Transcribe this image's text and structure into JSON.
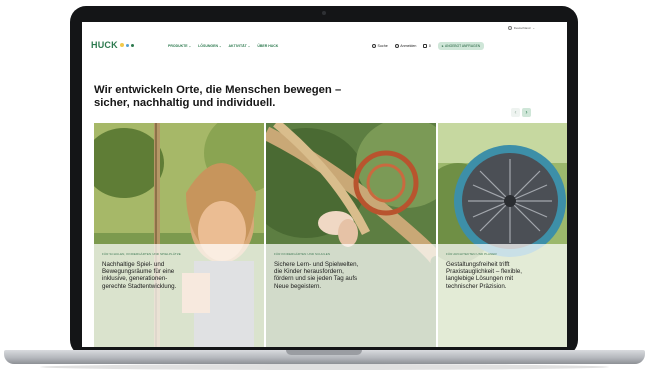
{
  "top_bar": {
    "language": "Deutschland"
  },
  "header": {
    "logo": "HUCK",
    "nav": [
      "PRODUKTE",
      "LÖSUNGEN",
      "AKTIVITÄT",
      "ÜBER HUCK"
    ],
    "search_label": "Suche",
    "login_label": "Anmelden",
    "cart_count": "0",
    "cta_label": "ANGEBOT ANFRAGEN"
  },
  "hero": {
    "headline_line1": "Wir entwickeln Orte, die Menschen bewegen –",
    "headline_line2": "sicher, nachhaltig und individuell."
  },
  "cards": [
    {
      "category": "FÜR SCHULEN, KINDERGÄRTEN UND SPIELPLÄTZE",
      "lines": [
        "Nachhaltige Spiel- und",
        "Bewegungsräume für eine",
        "inklusive, generationen-",
        "gerechte Stadtentwicklung."
      ]
    },
    {
      "category": "FÜR KINDERGÄRTEN UND SCHULEN",
      "lines": [
        "Sichere Lern- und Spielwelten,",
        "die Kinder herausfordern,",
        "fördern und sie jeden Tag aufs",
        "Neue begeistern."
      ]
    },
    {
      "category": "FÜR ARCHITEKTEN UND PLANER",
      "lines": [
        "Gestaltungsfreiheit trifft",
        "Praxistauglichkeit – flexible,",
        "langlebige Lösungen mit",
        "technischer Präzision."
      ]
    }
  ],
  "colors": {
    "brand_green": "#2d7a4f",
    "cta_bg": "#cfe6d8"
  },
  "icons": [
    "globe-icon",
    "search-icon",
    "user-icon",
    "cart-icon",
    "chevron-left-icon",
    "chevron-right-icon"
  ]
}
